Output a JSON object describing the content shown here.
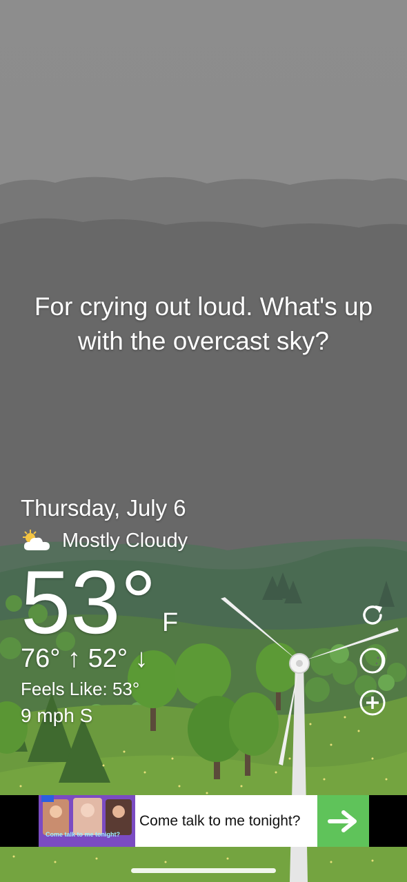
{
  "message": "For crying out loud. What's up with the overcast sky?",
  "weather": {
    "date": "Thursday, July 6",
    "condition": "Mostly Cloudy",
    "condition_icon": "partly-cloudy-icon",
    "temperature": "53°",
    "unit": "F",
    "hi_lo": "76° ↑  52° ↓",
    "feels_like": "Feels Like: 53°",
    "wind": "9 mph S"
  },
  "controls": {
    "refresh_icon": "refresh-icon",
    "theme_icon": "moon-icon",
    "add_icon": "add-icon"
  },
  "ad": {
    "image_caption": "Come talk to me tonight?",
    "text": "Come talk to me tonight?",
    "arrow_icon": "arrow-right-icon",
    "accent": "#5fc35a"
  },
  "colors": {
    "sky_top": "#8c8c8c",
    "sky_bottom": "#676767",
    "grass": "#6f9a3c",
    "far_hills": "#4d6e58"
  }
}
